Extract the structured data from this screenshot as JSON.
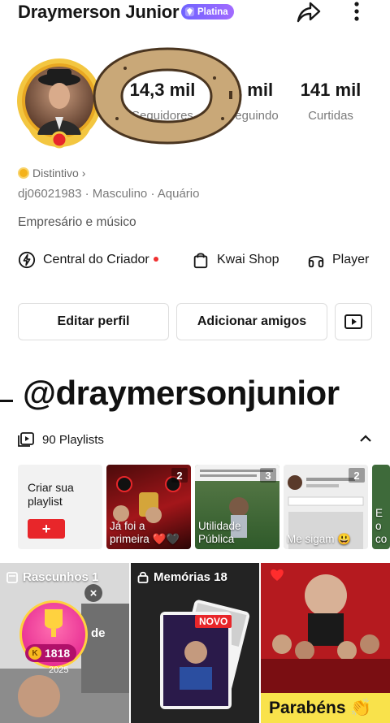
{
  "profile": {
    "name": "Draymerson Junior",
    "tier_badge": "Platina",
    "distintivo_label": "Distintivo",
    "id_line": "dj06021983  ·  Masculino  ·  Aquário",
    "bio": "Empresário e músico"
  },
  "stats": {
    "followers_value": "14,3 mil",
    "followers_label": "Seguidores",
    "following_value": "1 mil",
    "following_label": "Seguindo",
    "likes_value": "141 mil",
    "likes_label": "Curtidas"
  },
  "quick_links": {
    "creator": "Central do Criador",
    "shop": "Kwai Shop",
    "player": "Player"
  },
  "buttons": {
    "edit": "Editar perfil",
    "add_friends": "Adicionar amigos"
  },
  "overlay_handle": "@draymersonjunior",
  "playlists": {
    "count_label": "90 Playlists",
    "create_label": "Criar sua playlist",
    "create_button": "+",
    "cards": [
      {
        "caption": "Já foi a primeira ❤️🖤",
        "count": "2"
      },
      {
        "caption": "Utilidade Pública",
        "count": "3"
      },
      {
        "caption": "Me sigam 😃",
        "count": "2"
      },
      {
        "caption": "E o co",
        "count": ""
      }
    ]
  },
  "grid": {
    "drafts_label": "Rascunhos 1",
    "drafts_coins": "1818",
    "drafts_text": "de",
    "drafts_date": "2025",
    "memories_label": "Memórias 18",
    "memories_new": "NOVO",
    "congrats_label": "Parabéns 👏"
  },
  "colors": {
    "accent_red": "#e8262a",
    "badge_purple": "#7b64ff",
    "donut_brown": "#c9a878"
  }
}
